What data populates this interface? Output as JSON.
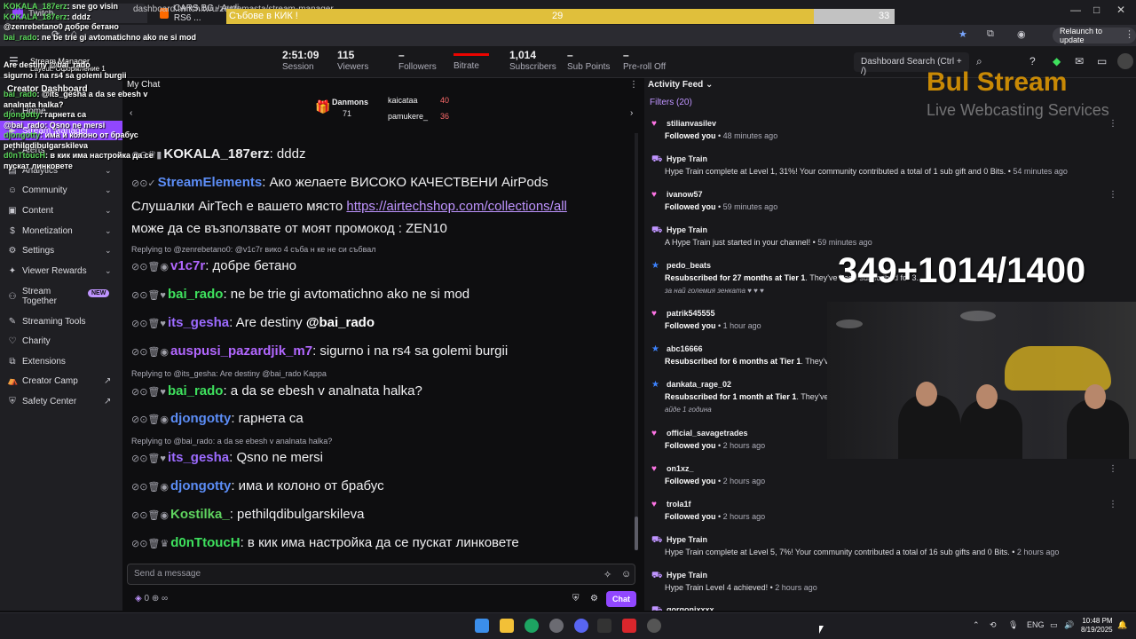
{
  "browser": {
    "tabs": [
      {
        "label": "Twitch",
        "icon": "twitch-icon"
      },
      {
        "label": "CARS.BG - Audi RS6 ...",
        "icon": "cars-icon"
      }
    ],
    "url": "dashboard.twitch.tv/u/zenremasta/stream-manager",
    "relaunch_label": "Relaunch to update"
  },
  "stats": [
    {
      "value": "2:51:09",
      "label": "Session"
    },
    {
      "value": "115",
      "label": "Viewers"
    },
    {
      "value": "–",
      "label": "Followers"
    },
    {
      "value": "",
      "label": "Bitrate"
    },
    {
      "value": "1,014",
      "label": "Subscribers"
    },
    {
      "value": "–",
      "label": "Sub Points"
    },
    {
      "value": "–",
      "label": "Pre-roll Off"
    }
  ],
  "search": {
    "placeholder": "Dashboard Search (Ctrl + /)"
  },
  "sidebar": {
    "title": "Creator Dashboard",
    "stream_manager": "Stream Manager",
    "layout": "Layout: Оформление 1",
    "items": [
      {
        "label": "Home",
        "icon": "home-icon"
      },
      {
        "label": "Stream Manager",
        "icon": "stream-icon"
      },
      {
        "label": "Alerts",
        "icon": "alerts-icon"
      },
      {
        "label": "Analytics",
        "icon": "analytics-icon"
      },
      {
        "label": "Community",
        "icon": "community-icon"
      },
      {
        "label": "Content",
        "icon": "content-icon"
      },
      {
        "label": "Monetization",
        "icon": "money-icon"
      },
      {
        "label": "Settings",
        "icon": "gear-icon"
      },
      {
        "label": "Viewer Rewards",
        "icon": "rewards-icon"
      },
      {
        "label": "Stream Together",
        "icon": "together-icon",
        "badge": "NEW"
      },
      {
        "label": "Streaming Tools",
        "icon": "tools-icon"
      },
      {
        "label": "Charity",
        "icon": "charity-icon"
      },
      {
        "label": "Extensions",
        "icon": "extensions-icon"
      },
      {
        "label": "Creator Camp",
        "icon": "camp-icon"
      },
      {
        "label": "Safety Center",
        "icon": "safety-icon"
      }
    ]
  },
  "chat": {
    "header": "My Chat",
    "gifters": [
      {
        "name": "Danmons",
        "count": "71"
      },
      {
        "name": "kaicataa",
        "count": "40"
      },
      {
        "name": "pamukere_",
        "count": "36"
      }
    ],
    "messages": [
      {
        "user": "KOKALA_187erz",
        "color": "#ffffff",
        "text": ": dddz"
      },
      {
        "user": "StreamElements",
        "color": "#5c8df6",
        "text": ": Ако желаете ВИСОКО КАЧЕСТВЕНИ AirPods"
      },
      {
        "user": "",
        "color": "",
        "text": "Слушалки AirTech е вашето място ",
        "link": "https://airtechshop.com/collections/all"
      },
      {
        "user": "",
        "color": "",
        "text": "може да се възползвате от моят промокод : ZEN10"
      },
      {
        "reply": "Replying to @zenrebetano0: @v1c7r вико 4 съба н ке не си събвал"
      },
      {
        "user": "v1c7r",
        "color": "#b267ff",
        "text": ": добре бетано"
      },
      {
        "user": "bai_rado",
        "color": "#3ee05d",
        "text": ": ne be trie gi avtomatichno ako ne si mod"
      },
      {
        "user": "its_gesha",
        "color": "#9c6bff",
        "text": ": Are destiny ",
        "mention": "@bai_rado"
      },
      {
        "user": "auspusi_pazardjik_m7",
        "color": "#b267ff",
        "text": ": sigurno i na rs4 sa golemi burgii"
      },
      {
        "reply": "Replying to @its_gesha: Are destiny @bai_rado Kappa"
      },
      {
        "user": "bai_rado",
        "color": "#3ee05d",
        "text": ": a da se ebesh v analnata halka?"
      },
      {
        "user": "djongotty",
        "color": "#5c8df6",
        "text": ": гарнета са"
      },
      {
        "reply": "Replying to @bai_rado: a da se ebesh v analnata halka?"
      },
      {
        "user": "its_gesha",
        "color": "#9c6bff",
        "text": ": Qsno ne mersi"
      },
      {
        "user": "djongotty",
        "color": "#5c8df6",
        "text": ": има и колоно от брабус"
      },
      {
        "user": "Kostilka_",
        "color": "#5fd35f",
        "text": ": pethilqdibulgarskileva"
      },
      {
        "user": "d0nTtoucH",
        "color": "#3ee05d",
        "text": ": в кик има настройка да се пускат линковете"
      }
    ],
    "input_placeholder": "Send a message",
    "send_label": "Chat",
    "points": "0"
  },
  "activity": {
    "title": "Activity Feed",
    "filters": "Filters (20)",
    "items": [
      {
        "type": "follow",
        "name": "stilianvasilev",
        "desc": "Followed you",
        "time": "48 minutes ago"
      },
      {
        "type": "hype",
        "name": "Hype Train",
        "desc": "Hype Train complete at Level 1, 31%! Your community contributed a total of 1 sub gift and 0 Bits.",
        "time": "54 minutes ago"
      },
      {
        "type": "follow",
        "name": "ivanow57",
        "desc": "Followed you",
        "time": "59 minutes ago"
      },
      {
        "type": "hype",
        "name": "Hype Train",
        "desc": "A Hype Train just started in your channel!",
        "time": "59 minutes ago"
      },
      {
        "type": "sub",
        "name": "pedo_beats",
        "desc": "Resubscribed for 27 months at",
        "tier": "Tier 1",
        "desc2": ". They've been subscribed for 3...",
        "msg": "за най големия зенката ♥ ♥ ♥"
      },
      {
        "type": "follow",
        "name": "patrik545555",
        "desc": "Followed you",
        "time": "1 hour ago"
      },
      {
        "type": "sub",
        "name": "abc16666",
        "desc": "Resubscribed for 6 months at",
        "tier": "Tier 1",
        "desc2": ". They've..."
      },
      {
        "type": "sub",
        "name": "dankata_rage_02",
        "desc": "Resubscribed for 1 month at",
        "tier": "Tier 1",
        "desc2": ". They've...",
        "msg": "айде 1 година"
      },
      {
        "type": "follow",
        "name": "official_savagetrades",
        "desc": "Followed you",
        "time": "2 hours ago"
      },
      {
        "type": "follow",
        "name": "on1xz_",
        "desc": "Followed you",
        "time": "2 hours ago"
      },
      {
        "type": "follow",
        "name": "trola1f",
        "desc": "Followed you",
        "time": "2 hours ago"
      },
      {
        "type": "hype",
        "name": "Hype Train",
        "desc": "Hype Train complete at Level 5, 7%! Your community contributed a total of 16 sub gifts and 0 Bits.",
        "time": "2 hours ago"
      },
      {
        "type": "hype",
        "name": "Hype Train",
        "desc": "Hype Train Level 4 achieved!",
        "time": "2 hours ago"
      },
      {
        "type": "follow",
        "name": "gorgonixxxx",
        "desc": "",
        "time": ""
      }
    ]
  },
  "overlay": {
    "goal_title": "Събове в КИК !",
    "goal_current": "29",
    "goal_target": "33",
    "goal_fraction": 0.879,
    "goal_counter": "349+1014/1400",
    "logo_main": "Bul Stream",
    "logo_sub": "Live Webcasting Services",
    "chat_lines": [
      {
        "user": "KOKALA_187erz",
        "text": ": sne go visin"
      },
      {
        "user": "KOKALA_187erz",
        "text": ": dddz"
      },
      {
        "user": "",
        "text": "@zenrebetano0 добре бетано"
      },
      {
        "user": "bai_rado",
        "text": ": ne be trie gi avtomatichno ako ne si mod"
      },
      {
        "user": "",
        "text": "Are destiny @bai_rado"
      },
      {
        "user": "",
        "text": "sigurno i na rs4 sa golemi burgii"
      },
      {
        "user": "bai_rado",
        "text": ": @its_gesha a da se ebesh v"
      },
      {
        "user": "",
        "text": "analnata halka?"
      },
      {
        "user": "djongotty",
        "text": ": гарнета са"
      },
      {
        "user": "",
        "text": "@bai_rado: Qsno ne mersi"
      },
      {
        "user": "djongotty",
        "text": ": има и колоно от брабус"
      },
      {
        "user": "",
        "text": "pethilqdibulgarskileva"
      },
      {
        "user": "d0nTtoucH",
        "text": ": в кик има настройка да се"
      },
      {
        "user": "",
        "text": "пускат линковете"
      }
    ]
  },
  "taskbar": {
    "lang": "ENG",
    "time": "10:48 PM",
    "date": "8/19/2025"
  },
  "colors": {
    "accent": "#9147ff",
    "live_red": "#eb0400",
    "goal_yellow": "#e0bf3b"
  }
}
